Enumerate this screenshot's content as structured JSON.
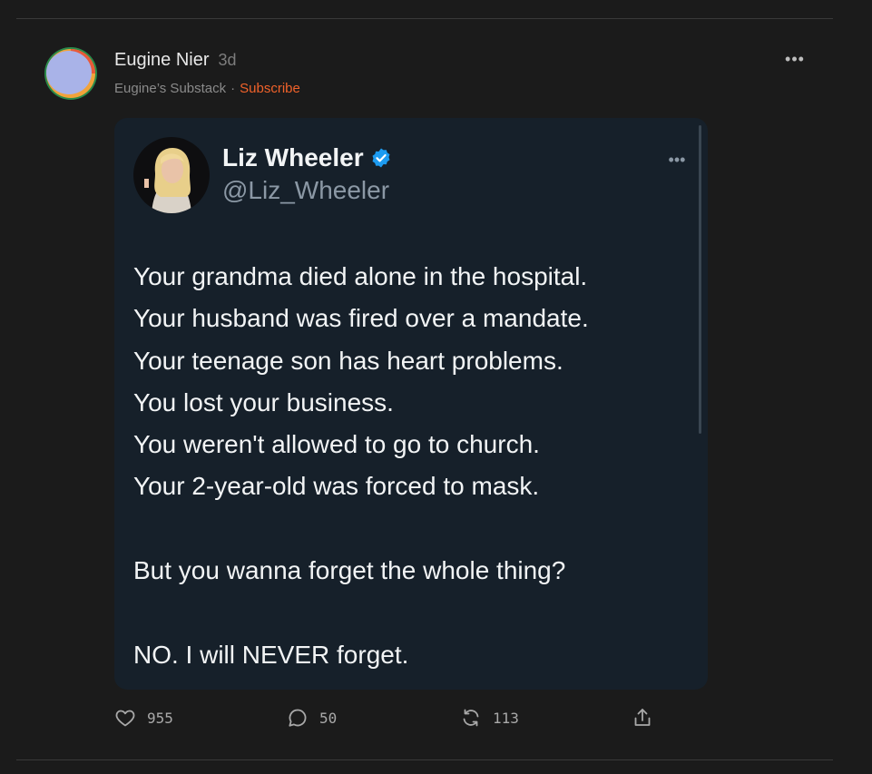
{
  "post": {
    "author_name": "Eugine Nier",
    "age": "3d",
    "publication": "Eugine’s Substack",
    "separator": "·",
    "subscribe_label": "Subscribe",
    "more_label": "•••"
  },
  "tweet": {
    "name": "Liz Wheeler",
    "handle": "@Liz_Wheeler",
    "more_label": "•••",
    "lines": [
      "Your grandma died alone in the hospital.",
      "Your husband was fired over a mandate.",
      "Your teenage son has heart problems.",
      "You lost your business.",
      "You weren't allowed to go to church.",
      "Your 2-year-old was forced to mask.",
      "But you wanna forget the whole thing?",
      "NO. I will NEVER forget."
    ]
  },
  "actions": {
    "likes": "955",
    "comments": "50",
    "restacks": "113"
  },
  "icons": {
    "like": "heart-icon",
    "comment": "comment-bubble-icon",
    "restack": "restack-icon",
    "share": "share-icon",
    "verified": "verified-badge-icon"
  },
  "colors": {
    "background": "#1b1b1b",
    "card": "#16202a",
    "accent": "#f0622a",
    "verified": "#1d9bf0"
  }
}
